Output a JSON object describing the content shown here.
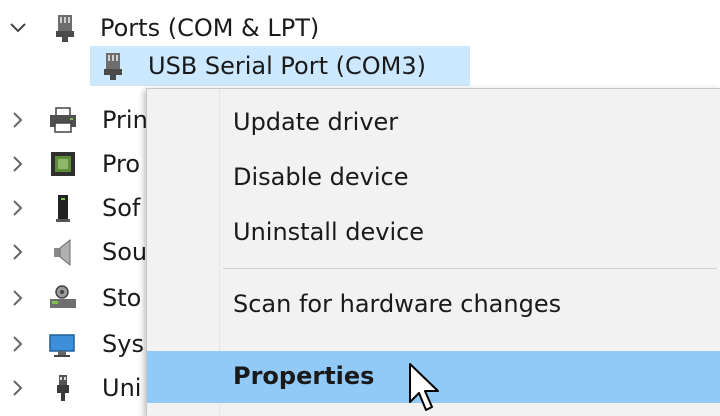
{
  "tree": {
    "ports": {
      "label": "Ports (COM & LPT)",
      "icon": "port-connector-icon",
      "expanded": true
    },
    "usb_serial": {
      "label": "USB Serial Port (COM3)",
      "icon": "port-connector-icon",
      "selected": true
    },
    "categories": [
      {
        "label": "Prin",
        "icon": "printer-icon"
      },
      {
        "label": "Pro",
        "icon": "processor-icon"
      },
      {
        "label": "Sof",
        "icon": "software-device-icon"
      },
      {
        "label": "Sou",
        "icon": "speaker-icon"
      },
      {
        "label": "Sto",
        "icon": "storage-controller-icon"
      },
      {
        "label": "Sys",
        "icon": "system-devices-icon"
      },
      {
        "label": "Uni",
        "icon": "usb-plug-icon"
      }
    ]
  },
  "context_menu": {
    "items": [
      {
        "label": "Update driver"
      },
      {
        "label": "Disable device"
      },
      {
        "label": "Uninstall device"
      },
      {
        "label": "Scan for hardware changes"
      },
      {
        "label": "Properties",
        "default": true,
        "hovered": true
      }
    ]
  },
  "colors": {
    "selection": "#cce8ff",
    "menu_background": "#f2f2f2",
    "menu_hover": "#91c9f7"
  }
}
